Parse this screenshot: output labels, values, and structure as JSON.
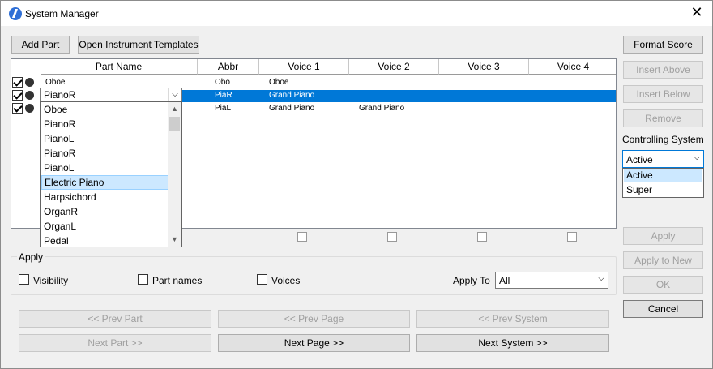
{
  "window": {
    "title": "System Manager",
    "close_glyph": "✕"
  },
  "toolbar": {
    "add_part": "Add Part",
    "open_templates": "Open Instrument Templates"
  },
  "right_buttons": {
    "format_score": "Format Score",
    "insert_above": "Insert Above",
    "insert_below": "Insert Below",
    "remove": "Remove",
    "controlling_system_label": "Controlling System",
    "apply": "Apply",
    "apply_to_new": "Apply to New",
    "ok": "OK",
    "cancel": "Cancel"
  },
  "controlling_system": {
    "value": "Active",
    "options": [
      "Active",
      "Super"
    ]
  },
  "table": {
    "columns": [
      "Part Name",
      "Abbr",
      "Voice 1",
      "Voice 2",
      "Voice 3",
      "Voice 4"
    ],
    "rows": [
      {
        "name": "Oboe",
        "abbr": "Obo",
        "v1": "Oboe",
        "v2": "",
        "checked": true
      },
      {
        "name": "PianoR",
        "abbr": "PiaR",
        "v1": "Grand Piano",
        "v2": "",
        "checked": true,
        "selected": true
      },
      {
        "name": "PianoL",
        "abbr": "PiaL",
        "v1": "Grand Piano",
        "v2": "Grand Piano",
        "checked": true
      }
    ]
  },
  "part_dropdown": {
    "value": "PianoR",
    "options": [
      "Oboe",
      "PianoR",
      "PianoL",
      "PianoR",
      "PianoL",
      "Electric Piano",
      "Harpsichord",
      "OrganR",
      "OrganL",
      "Pedal"
    ],
    "highlighted_index": 5
  },
  "apply_group": {
    "label": "Apply",
    "visibility": "Visibility",
    "part_names": "Part names",
    "voices": "Voices",
    "apply_to_label": "Apply To",
    "apply_to_value": "All"
  },
  "nav": {
    "prev_part": "<< Prev Part",
    "prev_page": "<< Prev Page",
    "prev_system": "<< Prev System",
    "next_part": "Next Part >>",
    "next_page": "Next Page >>",
    "next_system": "Next System >>"
  },
  "icons": {
    "dropdown_arrow": "chevron-down-icon",
    "app": "app-logo-icon"
  },
  "colors": {
    "selection": "#0078d7",
    "highlight": "#cce8ff"
  }
}
